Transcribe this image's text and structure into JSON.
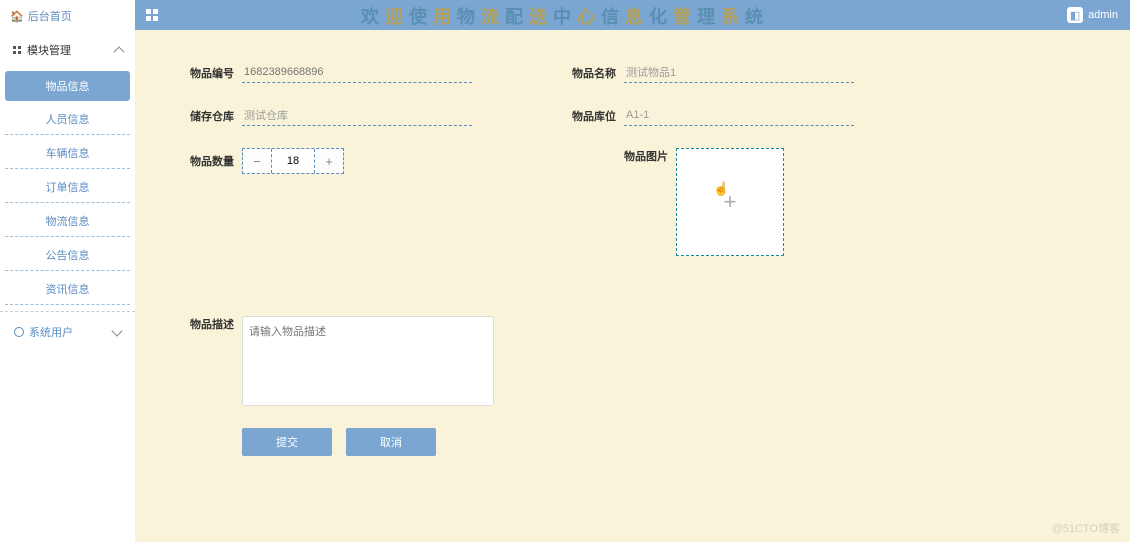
{
  "sidebar": {
    "home_label": "后台首页",
    "module_mgmt_label": "模块管理",
    "items": [
      {
        "label": "物品信息",
        "active": true
      },
      {
        "label": "人员信息",
        "active": false
      },
      {
        "label": "车辆信息",
        "active": false
      },
      {
        "label": "订单信息",
        "active": false
      },
      {
        "label": "物流信息",
        "active": false
      },
      {
        "label": "公告信息",
        "active": false
      },
      {
        "label": "资讯信息",
        "active": false
      }
    ],
    "sys_user_label": "系统用户"
  },
  "topbar": {
    "banner": "欢迎使用物流配送中心信息化管理系统",
    "username": "admin"
  },
  "form": {
    "goods_id": {
      "label": "物品编号",
      "placeholder": "1682389668896"
    },
    "goods_name": {
      "label": "物品名称",
      "value": "测试物品1"
    },
    "warehouse": {
      "label": "储存仓库",
      "value": "测试仓库"
    },
    "slot": {
      "label": "物品库位",
      "value": "A1-1"
    },
    "quantity": {
      "label": "物品数量",
      "value": "18"
    },
    "picture": {
      "label": "物品图片"
    },
    "desc": {
      "label": "物品描述",
      "placeholder": "请输入物品描述"
    },
    "submit_label": "提交",
    "cancel_label": "取消"
  },
  "watermark": "@51CTO博客"
}
